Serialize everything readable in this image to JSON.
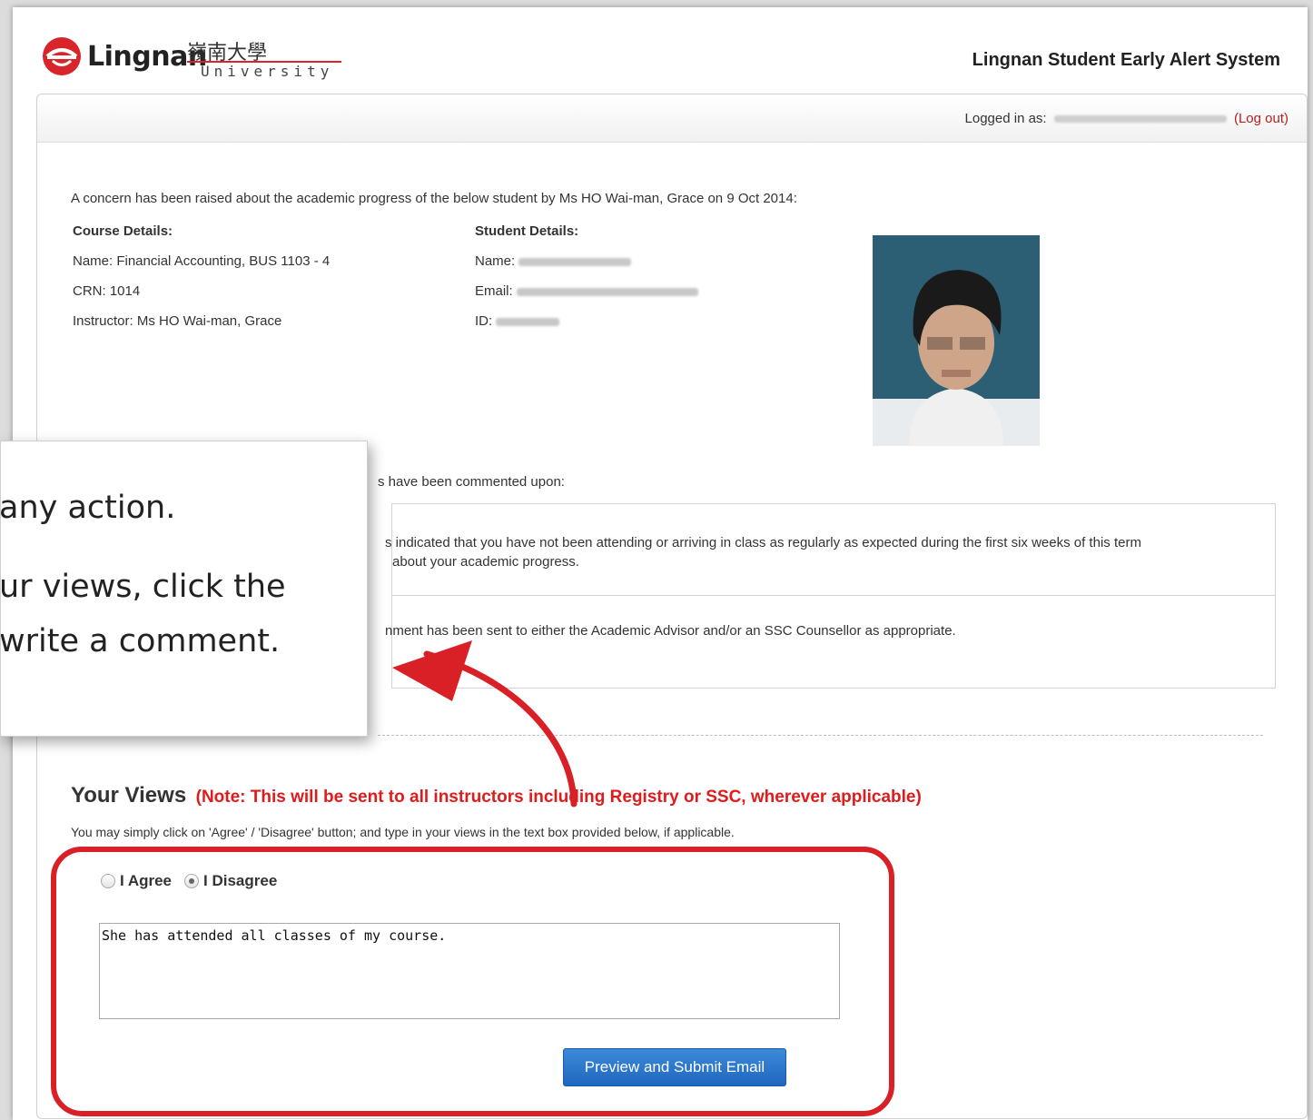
{
  "header": {
    "logo_text": "Lingnan",
    "logo_chinese": "嶺南大學",
    "logo_university": "University",
    "system_title": "Lingnan Student Early Alert System"
  },
  "login": {
    "prefix": "Logged in as:",
    "logout_label": "(Log out)"
  },
  "concern_text": "A concern has been raised about the academic progress of the below student by Ms HO Wai-man, Grace on 9 Oct 2014:",
  "course": {
    "heading": "Course Details:",
    "name": "Name: Financial Accounting, BUS 1103 - 4",
    "crn": "CRN: 1014",
    "instructor": "Instructor: Ms HO Wai-man, Grace"
  },
  "student": {
    "heading": "Student Details:",
    "name_label": "Name:",
    "email_label": "Email:",
    "id_label": "ID:"
  },
  "comments": {
    "intro": "s have been commented upon:",
    "line1": "s indicated that you have not been attending or arriving in class as regularly as expected during the first six weeks of this term",
    "line1b": "about your academic progress.",
    "line2": "nment has been sent to either the Academic Advisor and/or an SSC Counsellor as appropriate."
  },
  "views": {
    "title": "Your Views",
    "note": "(Note: This will be sent to all instructors including Registry or SSC, wherever applicable)",
    "instruction": "You may simply click on 'Agree' / 'Disagree' button; and type in your views in the text box provided below, if applicable.",
    "agree_label": "I Agree",
    "disagree_label": "I Disagree",
    "selected": "I Disagree",
    "comment_value": "She has attended all classes of my course.",
    "submit_label": "Preview and Submit Email"
  },
  "callout": {
    "line1": "any action.",
    "line2": "ur views, click the",
    "line3": "write a comment."
  },
  "colors": {
    "accent_red": "#d92027",
    "button_blue": "#1f66bf"
  }
}
